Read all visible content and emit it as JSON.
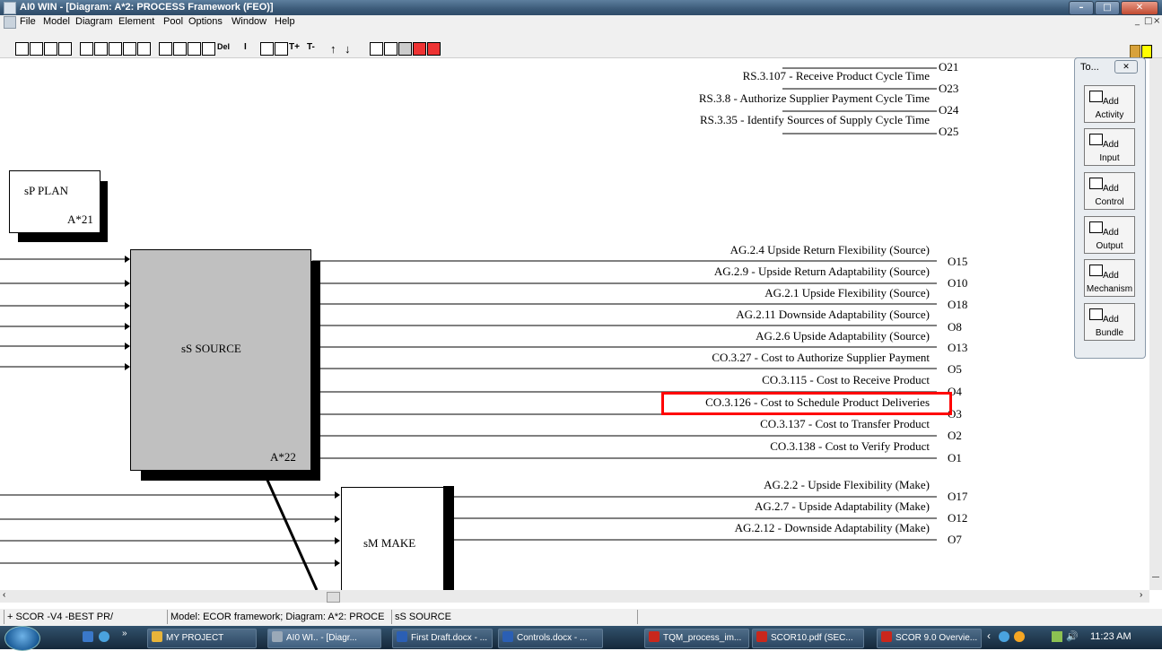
{
  "window": {
    "title": "AI0 WIN  - [Diagram: A*2: PROCESS Framework (FEO)]"
  },
  "menu": [
    "File",
    "Model",
    "Diagram",
    "Element",
    "Pool",
    "Options",
    "Window",
    "Help"
  ],
  "toolbar": {
    "text_buttons": [
      "Del",
      "I",
      "T+",
      "T-"
    ]
  },
  "palette": {
    "title": "To...",
    "buttons": [
      {
        "label": "Add",
        "sub": "Activity"
      },
      {
        "label": "Add",
        "sub": "Input"
      },
      {
        "label": "Add",
        "sub": "Control"
      },
      {
        "label": "Add",
        "sub": "Output"
      },
      {
        "label": "Add",
        "sub": "Mechanism"
      },
      {
        "label": "Add",
        "sub": "Bundle"
      }
    ]
  },
  "diagram": {
    "top_outputs": [
      {
        "label": "RS.3.107 - Receive Product Cycle Time",
        "code": "O23"
      },
      {
        "label": "RS.3.8 - Authorize Supplier Payment Cycle Time",
        "code": "O24"
      },
      {
        "label": "RS.3.35 - Identify Sources of Supply Cycle Time",
        "code": "O25"
      }
    ],
    "top_first_code": "O21",
    "plan_box": {
      "name": "sP PLAN",
      "id": "A*21"
    },
    "source_box": {
      "name": "sS SOURCE",
      "id": "A*22"
    },
    "make_box": {
      "name": "sM MAKE"
    },
    "source_outputs": [
      {
        "label": "AG.2.4 Upside Return Flexibility (Source)",
        "code": "O15"
      },
      {
        "label": "AG.2.9 -  Upside Return Adaptability (Source)",
        "code": "O10"
      },
      {
        "label": "AG.2.1 Upside Flexibility (Source)",
        "code": "O18"
      },
      {
        "label": "AG.2.11 Downside Adaptability (Source)",
        "code": "O8"
      },
      {
        "label": "AG.2.6 Upside Adaptability (Source)",
        "code": "O13"
      },
      {
        "label": "CO.3.27 - Cost to Authorize Supplier Payment",
        "code": "O5"
      },
      {
        "label": "CO.3.115 - Cost to Receive Product",
        "code": "O4"
      },
      {
        "label": "CO.3.126 - Cost to Schedule Product Deliveries",
        "code": "O3"
      },
      {
        "label": "CO.3.137 - Cost to Transfer Product",
        "code": "O2"
      },
      {
        "label": "CO.3.138 - Cost to Verify Product",
        "code": "O1"
      }
    ],
    "make_outputs": [
      {
        "label": "AG.2.2 - Upside Flexibility (Make)",
        "code": "O17"
      },
      {
        "label": "AG.2.7 - Upside Adaptability (Make)",
        "code": "O12"
      },
      {
        "label": "AG.2.12 - Downside Adaptability (Make)",
        "code": "O7"
      }
    ]
  },
  "status": {
    "cells": [
      "+ SCOR -V4 -BEST PR/",
      "Model: ECOR framework; Diagram: A*2: PROCE",
      "sS SOURCE"
    ]
  },
  "taskbar": {
    "tasks": [
      {
        "label": "MY PROJECT",
        "color": "#e8b43a"
      },
      {
        "label": "AI0 WI..  - [Diagr...",
        "color": "#9aa9b8"
      },
      {
        "label": "First Draft.docx - ...",
        "color": "#2b5fb4"
      },
      {
        "label": "Controls.docx - ...",
        "color": "#2b5fb4"
      },
      {
        "label": "TQM_process_im...",
        "color": "#c9271c"
      },
      {
        "label": "SCOR10.pdf (SEC...",
        "color": "#c9271c"
      },
      {
        "label": "SCOR 9.0 Overvie...",
        "color": "#c9271c"
      }
    ],
    "clock": "11:23 AM"
  },
  "colors": {
    "highlight": "#ff0000",
    "source_fill": "#c0c0c0",
    "title_bar": "#3b5a78"
  }
}
